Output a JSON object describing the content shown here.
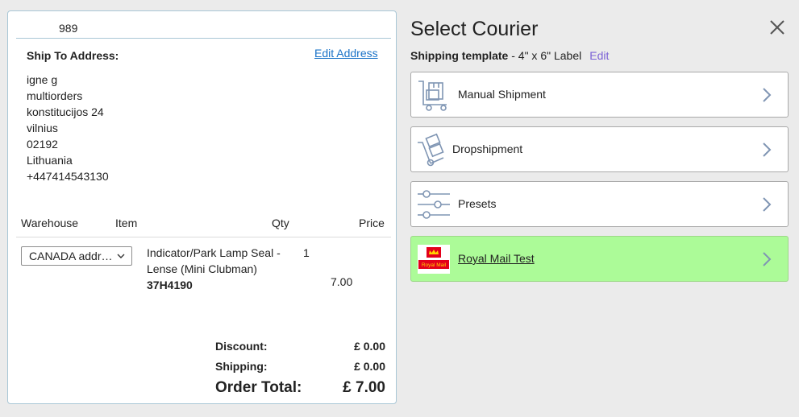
{
  "order": {
    "id": "989",
    "ship_to_heading": "Ship To Address:",
    "edit_address_label": "Edit Address",
    "address_lines": [
      "igne g",
      "multiorders",
      "konstitucijos 24",
      "vilnius",
      "02192",
      "Lithuania",
      "+447414543130"
    ]
  },
  "items_table": {
    "headers": {
      "warehouse": "Warehouse",
      "item": "Item",
      "qty": "Qty",
      "price": "Price"
    },
    "rows": [
      {
        "warehouse": "CANADA address",
        "item_name": "Indicator/Park Lamp Seal - Lense (Mini Clubman)",
        "sku": "37H4190",
        "qty": "1",
        "price": "7.00"
      }
    ]
  },
  "totals": {
    "discount_label": "Discount:",
    "discount_value": "£ 0.00",
    "shipping_label": "Shipping:",
    "shipping_value": "£ 0.00",
    "order_total_label": "Order Total:",
    "order_total_value": "£ 7.00"
  },
  "courier_panel": {
    "title": "Select Courier",
    "template_label": "Shipping template",
    "template_value": " - 4\" x 6\" Label",
    "edit_label": "Edit",
    "couriers": [
      {
        "label": "Manual Shipment",
        "icon": "cart-box-icon"
      },
      {
        "label": "Dropshipment",
        "icon": "hand-truck-icon"
      },
      {
        "label": "Presets",
        "icon": "sliders-icon"
      },
      {
        "label": "Royal Mail Test",
        "icon": "royal-mail-logo",
        "selected": true
      }
    ],
    "royal_mail_logo_text": "Royal Mail"
  },
  "colors": {
    "panel_border": "#a9c7d6",
    "link": "#1a73c8",
    "edit_purple": "#7b61d6",
    "selected_bg": "#acfb98",
    "icon_blue": "#7f95b3",
    "royal_mail_red": "#e3001b"
  }
}
